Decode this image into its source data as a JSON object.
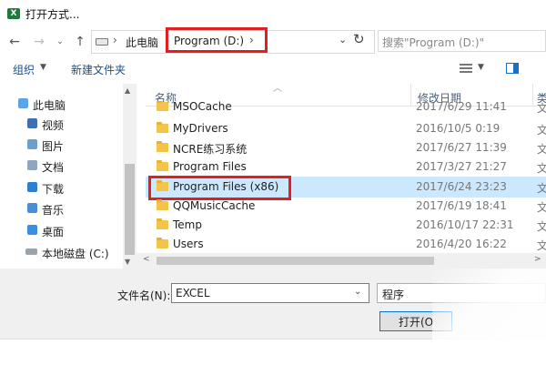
{
  "window": {
    "title": "打开方式..."
  },
  "address": {
    "crumbs": [
      "此电脑",
      "Program (D:)"
    ],
    "search_placeholder": "搜索\"Program (D:)\""
  },
  "toolbar": {
    "organize": "组织",
    "new_folder": "新建文件夹"
  },
  "nav": {
    "items": [
      {
        "label": "此电脑",
        "icon": "computer-icon"
      },
      {
        "label": "视频",
        "icon": "video-folder-icon"
      },
      {
        "label": "图片",
        "icon": "pictures-folder-icon"
      },
      {
        "label": "文档",
        "icon": "documents-folder-icon"
      },
      {
        "label": "下载",
        "icon": "downloads-folder-icon"
      },
      {
        "label": "音乐",
        "icon": "music-folder-icon"
      },
      {
        "label": "桌面",
        "icon": "desktop-folder-icon"
      },
      {
        "label": "本地磁盘 (C:)",
        "icon": "drive-icon"
      }
    ]
  },
  "list": {
    "columns": {
      "name": "名称",
      "date": "修改日期",
      "type": "类"
    },
    "rows": [
      {
        "name": "MSOCache",
        "date": "2017/6/29 11:41",
        "type": "文"
      },
      {
        "name": "MyDrivers",
        "date": "2016/10/5 0:19",
        "type": "文"
      },
      {
        "name": "NCRE练习系统",
        "date": "2017/6/27 11:39",
        "type": "文"
      },
      {
        "name": "Program Files",
        "date": "2017/3/27 21:27",
        "type": "文"
      },
      {
        "name": "Program Files (x86)",
        "date": "2017/6/24 23:23",
        "type": "文",
        "selected": true
      },
      {
        "name": "QQMusicCache",
        "date": "2017/6/19 18:41",
        "type": "文"
      },
      {
        "name": "Temp",
        "date": "2016/10/17 22:31",
        "type": "文"
      },
      {
        "name": "Users",
        "date": "2016/4/20 16:22",
        "type": "文"
      }
    ]
  },
  "footer": {
    "filename_label": "文件名(N):",
    "filename_value": "EXCEL",
    "filetype_value": "程序",
    "open_label": "打开(O"
  },
  "colors": {
    "highlight_red": "#e02020",
    "selection": "#cce8ff",
    "folder": "#f3c34a",
    "link_blue": "#1a4f8b"
  }
}
